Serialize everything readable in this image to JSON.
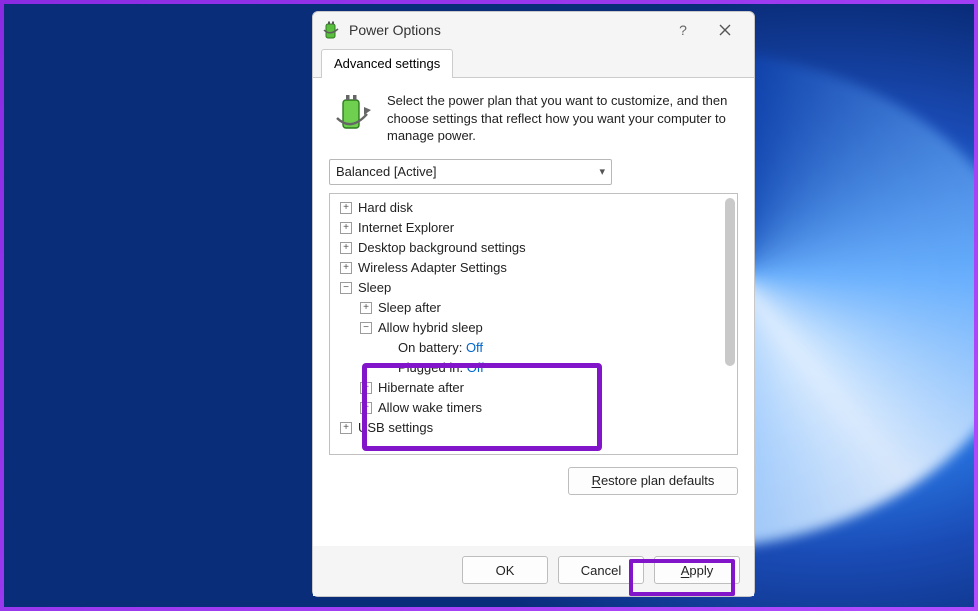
{
  "window": {
    "title": "Power Options",
    "help_tooltip": "Help",
    "close_tooltip": "Close"
  },
  "tab": {
    "label": "Advanced settings"
  },
  "description": "Select the power plan that you want to customize, and then choose settings that reflect how you want your computer to manage power.",
  "plan_select": {
    "value": "Balanced [Active]"
  },
  "tree": {
    "hard_disk": "Hard disk",
    "ie": "Internet Explorer",
    "desktop_bg": "Desktop background settings",
    "wireless": "Wireless Adapter Settings",
    "sleep": "Sleep",
    "sleep_after": "Sleep after",
    "allow_hybrid": "Allow hybrid sleep",
    "on_battery_label": "On battery:",
    "on_battery_value": "Off",
    "plugged_in_label": "Plugged in:",
    "plugged_in_value": "Off",
    "hibernate_after": "Hibernate after",
    "allow_wake": "Allow wake timers",
    "usb": "USB settings"
  },
  "buttons": {
    "restore": "Restore plan defaults",
    "restore_mn": "R",
    "ok": "OK",
    "cancel": "Cancel",
    "apply": "Apply",
    "apply_mn": "A"
  }
}
